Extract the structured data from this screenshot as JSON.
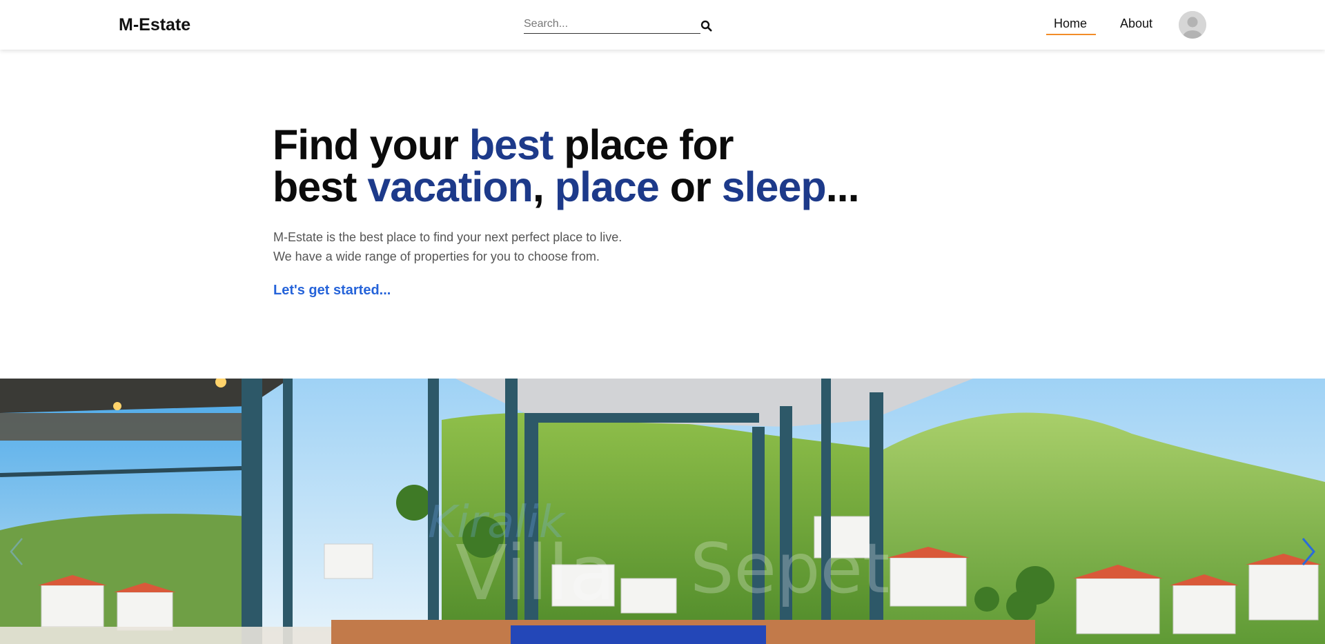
{
  "header": {
    "logo": "M-Estate",
    "search": {
      "placeholder": "Search..."
    },
    "nav": [
      {
        "label": "Home",
        "active": true
      },
      {
        "label": "About",
        "active": false
      }
    ],
    "accent_color": "#f28c28"
  },
  "hero": {
    "title_line1": {
      "t1": "Find your ",
      "h1": "best",
      "t2": " place for"
    },
    "title_line2": {
      "t1": "best ",
      "h1": "vacation",
      "t2": ", ",
      "h2": "place",
      "t3": " or ",
      "h3": "sleep",
      "t4": "..."
    },
    "highlight_color": "#1d3a8a",
    "description_line1": "M-Estate is the best place to find your next perfect place to live.",
    "description_line2": "We have a wide range of properties for you to choose from.",
    "cta": "Let's get started...",
    "cta_color": "#2563d9"
  },
  "carousel": {
    "prev_icon": "chevron-left-icon",
    "next_icon": "chevron-right-icon"
  }
}
